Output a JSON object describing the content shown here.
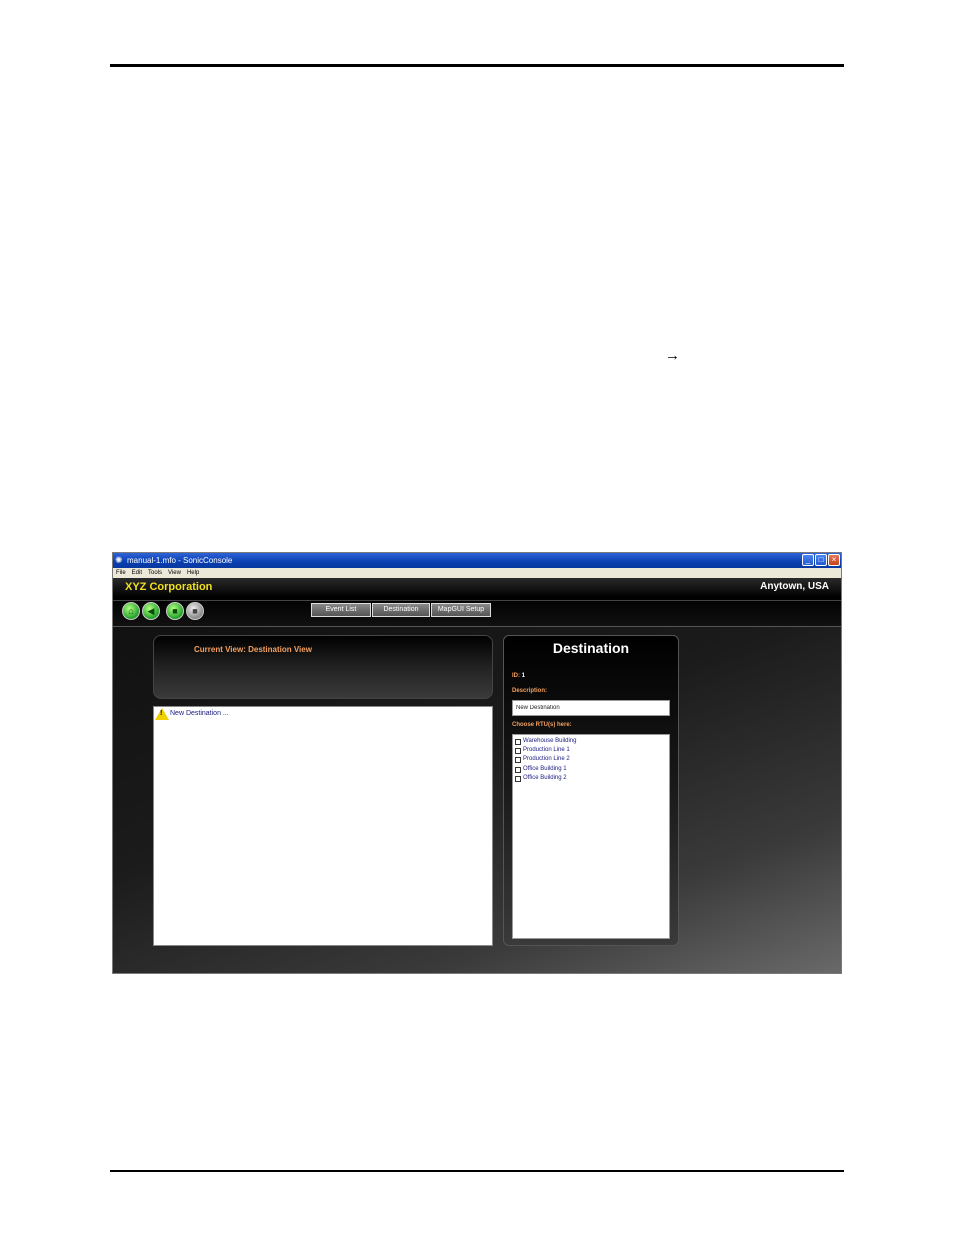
{
  "page": {
    "arrow_glyph": "→"
  },
  "window": {
    "title": "manual-1.mfo - SonicConsole",
    "menu": [
      "File",
      "Edit",
      "Tools",
      "View",
      "Help"
    ],
    "controls": {
      "minimize": "_",
      "maximize": "□",
      "close": "×"
    }
  },
  "header": {
    "company": "XYZ Corporation",
    "location": "Anytown, USA",
    "tabs": [
      "Event List",
      "Destination",
      "MapGUI Setup"
    ],
    "icons": [
      "home-icon",
      "back-icon",
      "play-icon",
      "stop-icon"
    ]
  },
  "view": {
    "current_view": "Current View: Destination View",
    "list_items": [
      "New Destination ..."
    ]
  },
  "destination": {
    "title": "Destination",
    "id_label": "ID:",
    "id_value": "1",
    "description_label": "Description:",
    "description_value": "New Destination",
    "rtu_label": "Choose RTU(s) here:",
    "rtus": [
      "Warehouse Building",
      "Production Line 1",
      "Production Line 2",
      "Office Building 1",
      "Office Building 2"
    ]
  }
}
